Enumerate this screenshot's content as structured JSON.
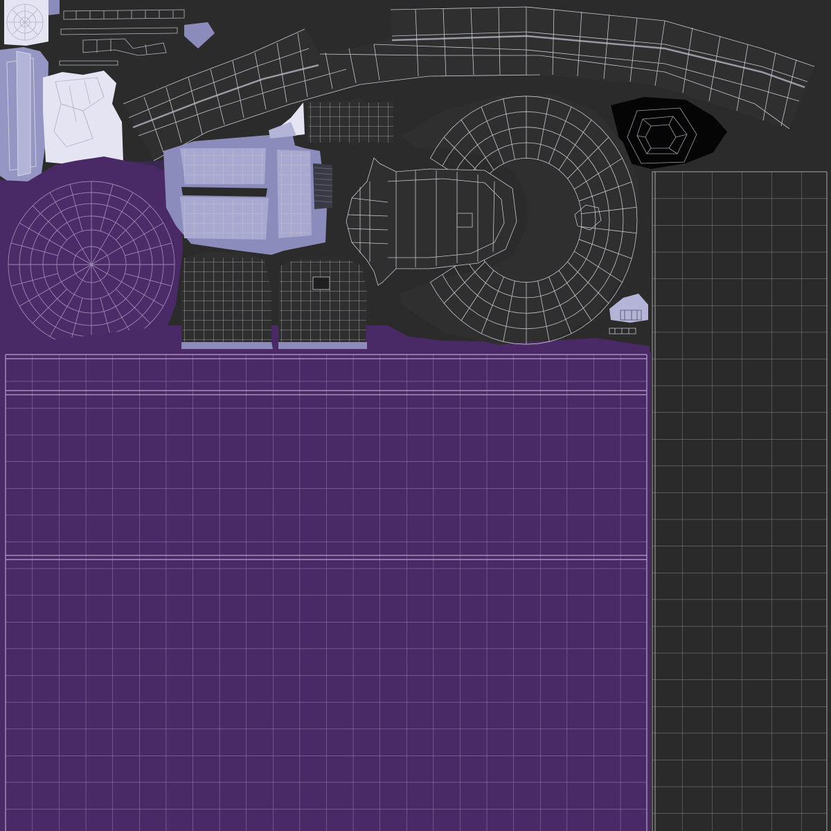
{
  "texture_atlas": {
    "description_label": "",
    "colors": {
      "background": "#2b2b2b",
      "purple_fabric": "#4a2a66",
      "purple_fabric_dark": "#3d2057",
      "lavender": "#8c8cbc",
      "lavender_light": "#e4e4f2",
      "lavender_mid": "#b4b4d8",
      "dark_shell": "#2f2f2f",
      "black_patch": "#050505",
      "wire": "#c9c9d2",
      "wire_on_purple": "#9c88b4"
    },
    "icons": [
      "uv-wireframe-grid",
      "uv-radial-disc",
      "uv-curved-strip"
    ]
  }
}
